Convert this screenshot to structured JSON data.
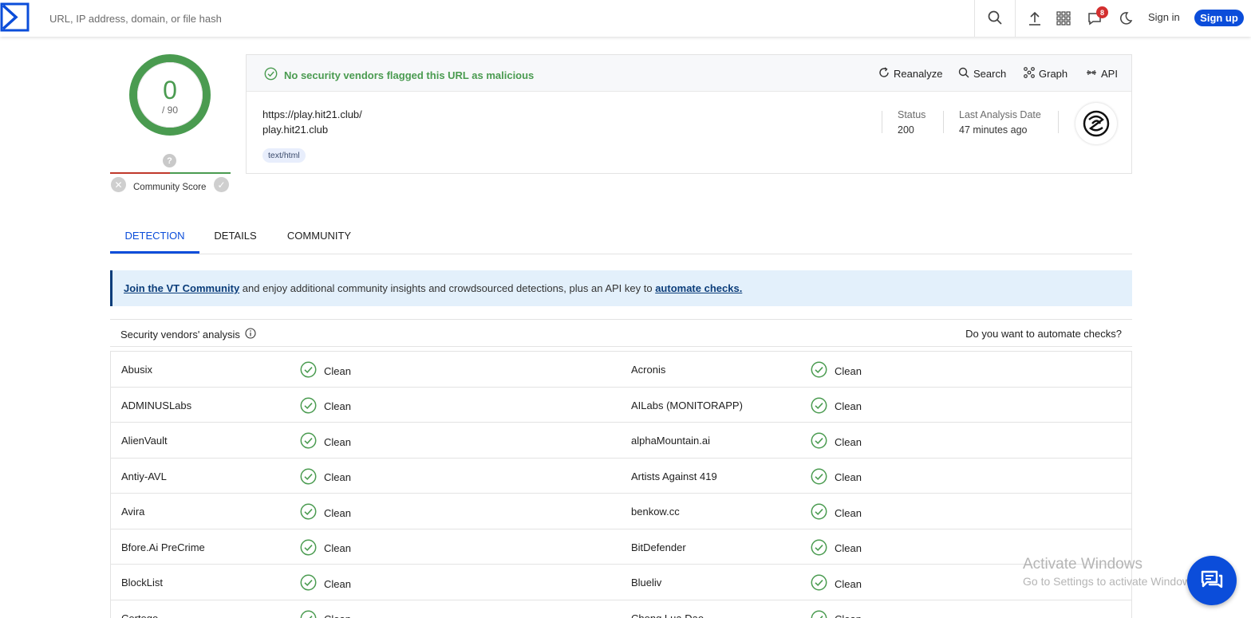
{
  "search": {
    "placeholder": "URL, IP address, domain, or file hash"
  },
  "topbar": {
    "notification_count": "8",
    "signin_label": "Sign in",
    "signup_label": "Sign up"
  },
  "score": {
    "detections": "0",
    "total": "/ 90",
    "community_pin": "?",
    "community_label": "Community Score"
  },
  "summary": {
    "verdict": "No security vendors flagged this URL as malicious",
    "actions": {
      "reanalyze": "Reanalyze",
      "search": "Search",
      "graph": "Graph",
      "api": "API"
    },
    "url": "https://play.hit21.club/",
    "domain": "play.hit21.club",
    "tag": "text/html",
    "status_label": "Status",
    "status_value": "200",
    "date_label": "Last Analysis Date",
    "date_value": "47 minutes ago"
  },
  "tabs": [
    "DETECTION",
    "DETAILS",
    "COMMUNITY"
  ],
  "banner": {
    "link1": "Join the VT Community",
    "text": " and enjoy additional community insights and crowdsourced detections, plus an API key to ",
    "link2": "automate checks."
  },
  "vendors": {
    "title": "Security vendors' analysis",
    "automate": "Do you want to automate checks?",
    "rows": [
      {
        "left": "Abusix",
        "left_result": "Clean",
        "right": "Acronis",
        "right_result": "Clean"
      },
      {
        "left": "ADMINUSLabs",
        "left_result": "Clean",
        "right": "AILabs (MONITORAPP)",
        "right_result": "Clean"
      },
      {
        "left": "AlienVault",
        "left_result": "Clean",
        "right": "alphaMountain.ai",
        "right_result": "Clean"
      },
      {
        "left": "Antiy-AVL",
        "left_result": "Clean",
        "right": "Artists Against 419",
        "right_result": "Clean"
      },
      {
        "left": "Avira",
        "left_result": "Clean",
        "right": "benkow.cc",
        "right_result": "Clean"
      },
      {
        "left": "Bfore.Ai PreCrime",
        "left_result": "Clean",
        "right": "BitDefender",
        "right_result": "Clean"
      },
      {
        "left": "BlockList",
        "left_result": "Clean",
        "right": "Blueliv",
        "right_result": "Clean"
      },
      {
        "left": "Certego",
        "left_result": "Clean",
        "right": "Chong Lua Dao",
        "right_result": "Clean"
      }
    ]
  },
  "watermark": {
    "line1": "Activate Windows",
    "line2": "Go to Settings to activate Windows."
  },
  "colors": {
    "accent": "#0b4dda",
    "clean": "#4a9b50",
    "danger": "#d32f2f"
  }
}
